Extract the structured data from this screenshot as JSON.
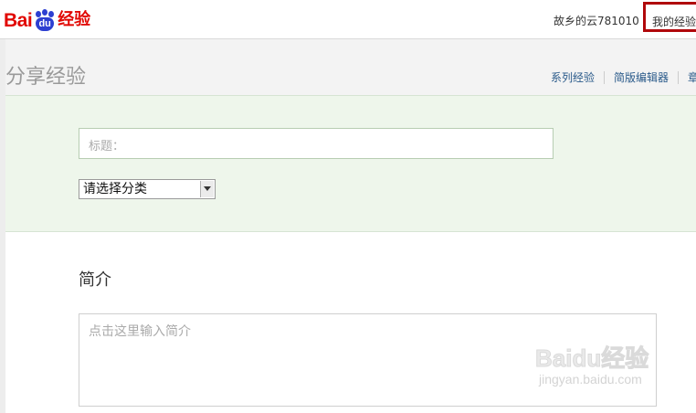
{
  "header": {
    "logo": {
      "latin": "Bai",
      "paw": "du",
      "cn": "经验"
    },
    "username": "故乡的云781010",
    "my_experience": "我的经验"
  },
  "page": {
    "title": "分享经验",
    "links": [
      "系列经验",
      "简版编辑器",
      "章"
    ]
  },
  "form": {
    "title_placeholder": "标题：",
    "category_selected": "请选择分类",
    "intro_label": "简介",
    "intro_placeholder": "点击这里输入简介"
  },
  "watermark": {
    "logo": "Baidu经验",
    "url": "jingyan.baidu.com"
  },
  "colors": {
    "brand_red": "#e10601",
    "paw_blue": "#2d3fd1",
    "highlight_box": "#b0080b",
    "form_green": "#eef6eb"
  }
}
